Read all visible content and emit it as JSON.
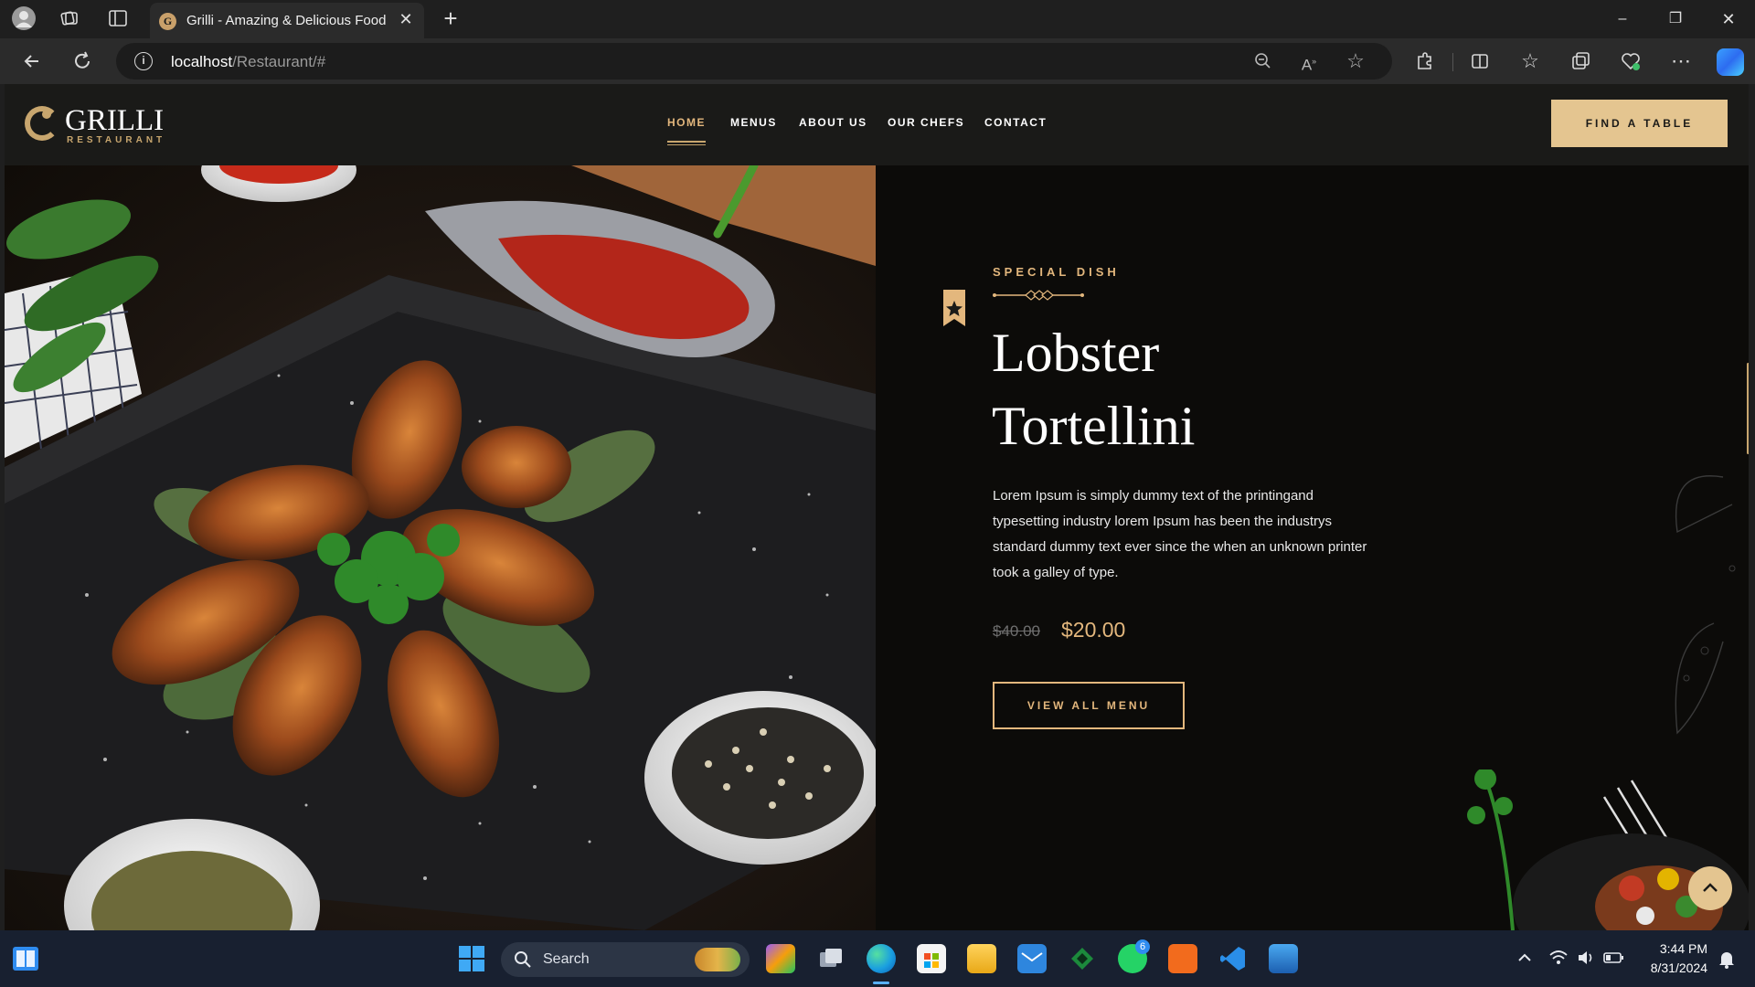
{
  "browser": {
    "tab_title": "Grilli - Amazing & Delicious Food",
    "tab_close": "✕",
    "new_tab": "+",
    "url_host": "localhost",
    "url_path": "/Restaurant/#",
    "window_controls": [
      "–",
      "❐",
      "✕"
    ]
  },
  "site": {
    "logo_name": "GRILLI",
    "logo_sub": "RESTAURANT",
    "nav": [
      {
        "label": "HOME",
        "active": true
      },
      {
        "label": "MENUS",
        "active": false
      },
      {
        "label": "ABOUT US",
        "active": false
      },
      {
        "label": "OUR CHEFS",
        "active": false
      },
      {
        "label": "CONTACT",
        "active": false
      }
    ],
    "cta": "FIND A TABLE"
  },
  "special": {
    "label": "SPECIAL DISH",
    "title_line1": "Lobster",
    "title_line2": "Tortellini",
    "description": "Lorem Ipsum is simply dummy text of the printingand typesetting industry lorem Ipsum has been the industrys standard dummy text ever since the when an unknown printer took a galley of type.",
    "old_price": "$40.00",
    "new_price": "$20.00",
    "button": "VIEW ALL MENU"
  },
  "taskbar": {
    "search_label": "Search",
    "whatsapp_badge": "6",
    "time": "3:44 PM",
    "date": "8/31/2024"
  },
  "colors": {
    "accent_gold": "#e3b77d",
    "button_gold": "#e4c590",
    "page_bg": "#0c0b09",
    "header_bg": "#1a1a18",
    "taskbar_bg": "#182030"
  }
}
